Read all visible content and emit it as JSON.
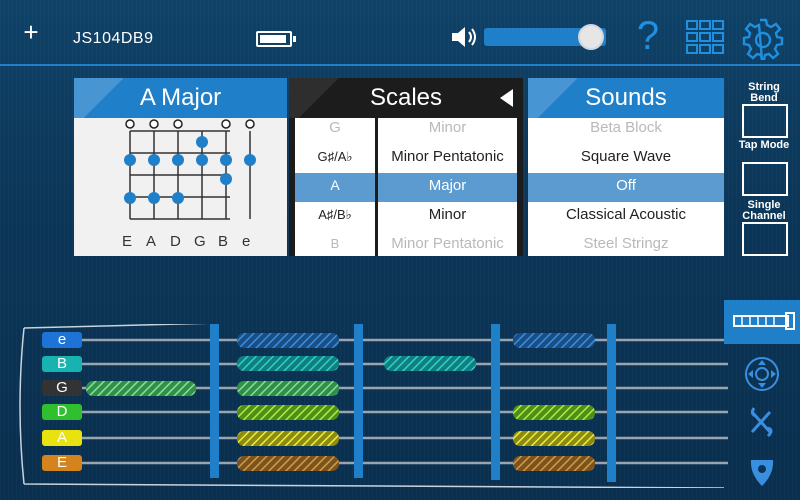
{
  "topbar": {
    "device_name": "JS104DB9",
    "volume": 0.88,
    "accent": "#1f7fc9"
  },
  "icons": {
    "add": "plus-icon",
    "battery": "battery-icon",
    "volume": "speaker-icon",
    "help": "question-mark-icon",
    "layout": "grid-icon",
    "settings": "gear-icon"
  },
  "chord": {
    "title": "A Major",
    "strings": [
      "E",
      "A",
      "D",
      "G",
      "B",
      "e"
    ]
  },
  "scales": {
    "title": "Scales",
    "roots": [
      "G",
      "G♯/A♭",
      "A",
      "A♯/B♭",
      "B"
    ],
    "types": [
      "Minor",
      "Minor Pentatonic",
      "Major",
      "Minor",
      "Minor Pentatonic"
    ],
    "selected_root": "A",
    "selected_type": "Major"
  },
  "sounds": {
    "title": "Sounds",
    "options": [
      "Beta Block",
      "Square Wave",
      "Off",
      "Classical Acoustic",
      "Steel Stringz"
    ],
    "selected": "Off"
  },
  "toggles": {
    "string_bend": "String Bend",
    "tap_mode": "Tap Mode",
    "single_channel": "Single Channel"
  },
  "strings": [
    {
      "label": "e",
      "color": "#1e74d6"
    },
    {
      "label": "B",
      "color": "#18b3b0"
    },
    {
      "label": "G",
      "color": "#333333"
    },
    {
      "label": "D",
      "color": "#2fbf2f"
    },
    {
      "label": "A",
      "color": "#e8e20f"
    },
    {
      "label": "E",
      "color": "#d4831d"
    }
  ],
  "tools": [
    "fretboard-tool-icon",
    "dpad-tool-icon",
    "tuning-tool-icon",
    "pick-tool-icon"
  ]
}
